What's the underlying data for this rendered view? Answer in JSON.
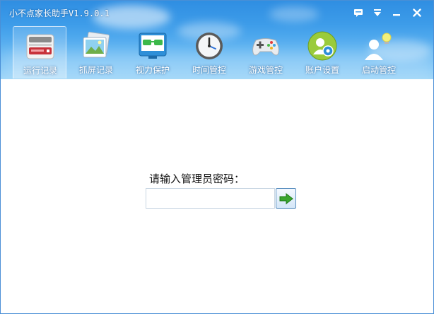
{
  "window": {
    "title": "小不点家长助手V1.9.0.1"
  },
  "tabs": [
    {
      "id": "run-log",
      "label": "运行记录",
      "active": true
    },
    {
      "id": "screenshot-log",
      "label": "抓屏记录",
      "active": false
    },
    {
      "id": "eye-protection",
      "label": "视力保护",
      "active": false
    },
    {
      "id": "time-control",
      "label": "时间管控",
      "active": false
    },
    {
      "id": "game-control",
      "label": "游戏管控",
      "active": false
    },
    {
      "id": "account-settings",
      "label": "账户设置",
      "active": false
    },
    {
      "id": "startup-control",
      "label": "启动管控",
      "active": false
    }
  ],
  "login": {
    "prompt": "请输入管理员密码：",
    "password_value": "",
    "password_placeholder": ""
  },
  "colors": {
    "header_top": "#2f8ee2",
    "header_bottom": "#9dd5f8",
    "window_border": "#4a8fd6",
    "go_arrow": "#3aa52e"
  },
  "icons": {
    "feedback": "chat-bubble-icon",
    "menu": "dropdown-menu-icon",
    "minimize": "minimize-icon",
    "close": "close-icon",
    "submit": "green-arrow-right-icon"
  }
}
